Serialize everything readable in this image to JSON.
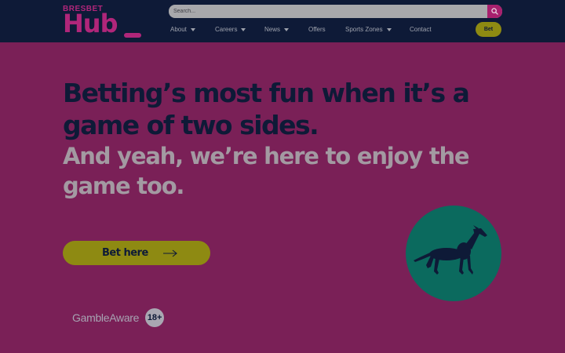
{
  "header": {
    "logo_top": "BRESBET",
    "logo_main": "Hub",
    "search_placeholder": "Search...",
    "nav": [
      {
        "label": "About"
      },
      {
        "label": "Careers"
      },
      {
        "label": "News"
      },
      {
        "label": "Offers"
      },
      {
        "label": "Sports Zones"
      },
      {
        "label": "Contact"
      }
    ],
    "bet_label": "Bet"
  },
  "hero": {
    "headline_line1": "Betting’s most fun when it’s a",
    "headline_line2": "game of two sides.",
    "subline_line1": "And yeah, we’re here to enjoy the",
    "subline_line2": "game too.",
    "cta_label": "Bet here"
  },
  "footer": {
    "gamble_aware": "GambleAware",
    "age_badge": "18+"
  },
  "colors": {
    "background": "#7a2057",
    "header": "#0e1a37",
    "accent_pink": "#b0267a",
    "accent_yellow": "#8e8a12",
    "circle_teal": "#0b6a5e"
  },
  "icons": {
    "search": "search-icon",
    "caret": "chevron-down-icon",
    "arrow": "arrow-right-icon",
    "dog": "greyhound-illustration"
  }
}
